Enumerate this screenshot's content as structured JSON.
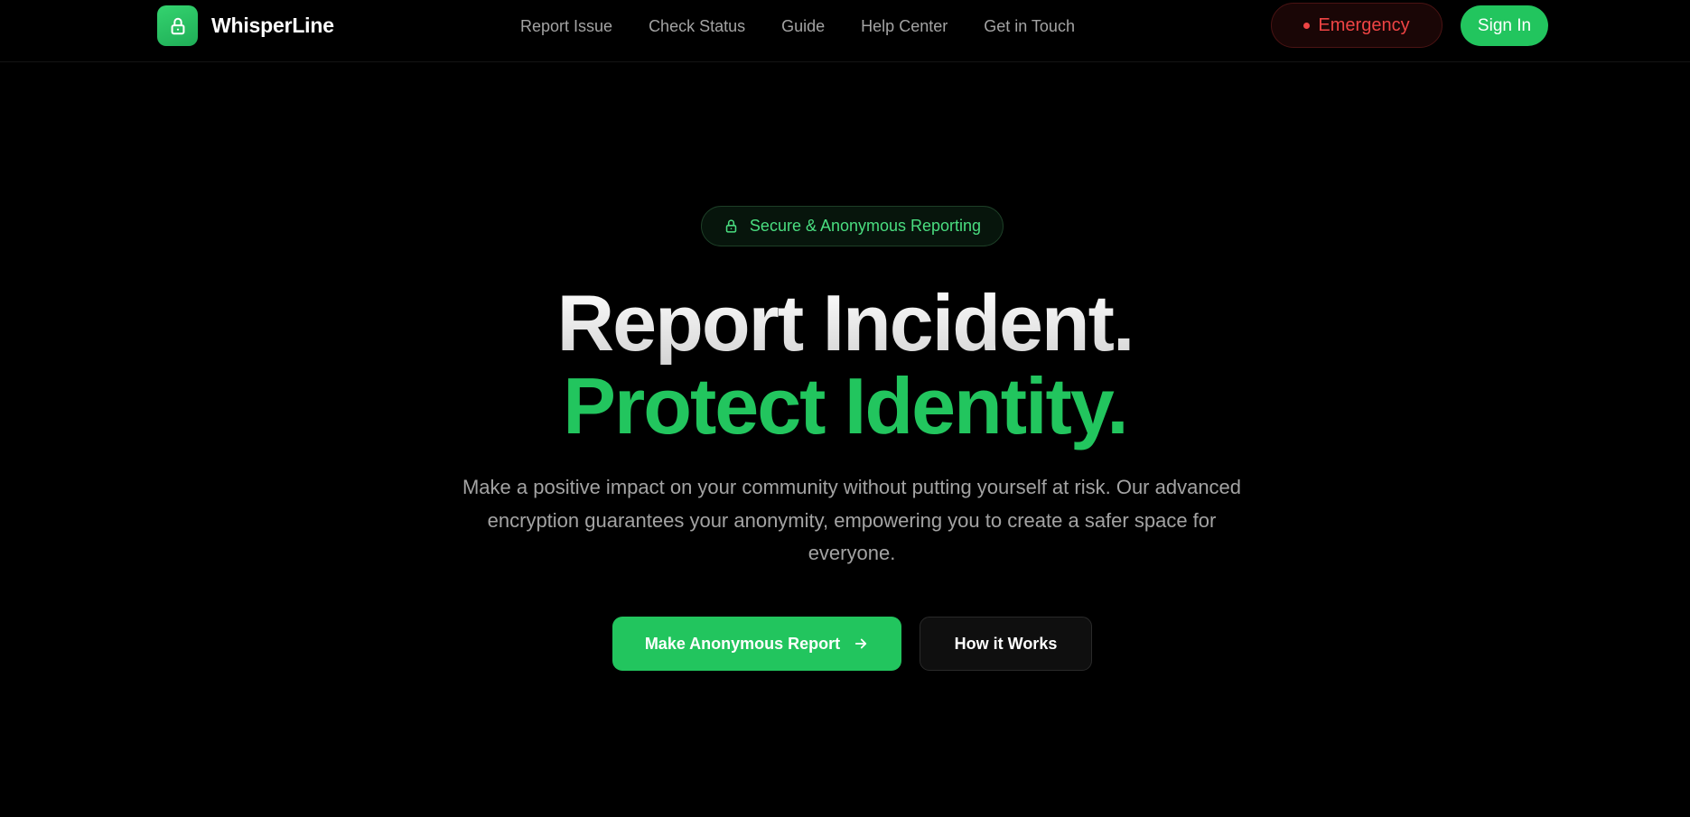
{
  "header": {
    "brand": {
      "name": "WhisperLine",
      "icon": "lock-icon"
    },
    "nav": [
      "Report Issue",
      "Check Status",
      "Guide",
      "Help Center",
      "Get in Touch"
    ],
    "emergency_label": "Emergency",
    "signin_label": "Sign In"
  },
  "hero": {
    "badge": {
      "icon": "lock-icon",
      "label": "Secure & Anonymous Reporting"
    },
    "headline_line1": "Report Incident.",
    "headline_line2": "Protect Identity.",
    "subtitle": "Make a positive impact on your community without putting yourself at risk. Our advanced encryption guarantees your anonymity, empowering you to create a safer space for everyone.",
    "primary_cta": {
      "label": "Make Anonymous Report",
      "icon": "arrow-right-icon"
    },
    "secondary_cta": {
      "label": "How it Works"
    }
  },
  "colors": {
    "background": "#000000",
    "accent": "#22c55e",
    "emergency": "#ef4444",
    "muted_text": "#a3a3a3"
  }
}
